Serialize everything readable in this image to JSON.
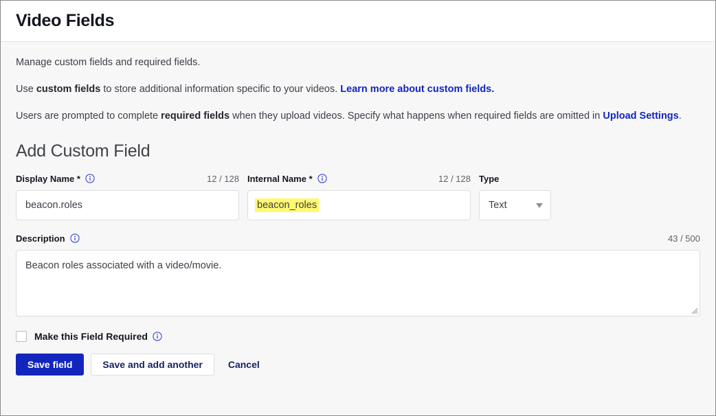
{
  "header": {
    "title": "Video Fields"
  },
  "intro": {
    "line1": "Manage custom fields and required fields.",
    "line2_part1": "Use ",
    "line2_bold1": "custom fields",
    "line2_part2": " to store additional information specific to your videos. ",
    "line2_link": "Learn more about custom fields.",
    "line3_part1": "Users are prompted to complete ",
    "line3_bold1": "required fields",
    "line3_part2": " when they upload videos. Specify what happens when required fields are omitted in ",
    "line3_link": "Upload Settings",
    "line3_part3": "."
  },
  "section": {
    "title": "Add Custom Field"
  },
  "form": {
    "display_name": {
      "label": "Display Name *",
      "counter": "12 / 128",
      "value": "beacon.roles",
      "info_icon": "info-icon"
    },
    "internal_name": {
      "label": "Internal Name *",
      "counter": "12 / 128",
      "value": "beacon_roles",
      "highlight_color": "#fff870",
      "info_icon": "info-icon"
    },
    "type": {
      "label": "Type",
      "value": "Text",
      "chevron_icon": "chevron-down-icon"
    },
    "description": {
      "label": "Description",
      "counter": "43 / 500",
      "value": "Beacon roles associated with a video/movie.",
      "info_icon": "info-icon",
      "resize_icon": "resize-grip-icon"
    },
    "required_checkbox": {
      "label": "Make this Field Required",
      "checked": false,
      "info_icon": "info-icon"
    }
  },
  "actions": {
    "save": "Save field",
    "save_and_add": "Save and add another",
    "cancel": "Cancel"
  },
  "colors": {
    "accent_blue": "#1226be",
    "link_blue": "#1226be",
    "highlight_yellow": "#fff870",
    "body_background": "#f7f7f8",
    "border_gray": "#dcdde1"
  }
}
